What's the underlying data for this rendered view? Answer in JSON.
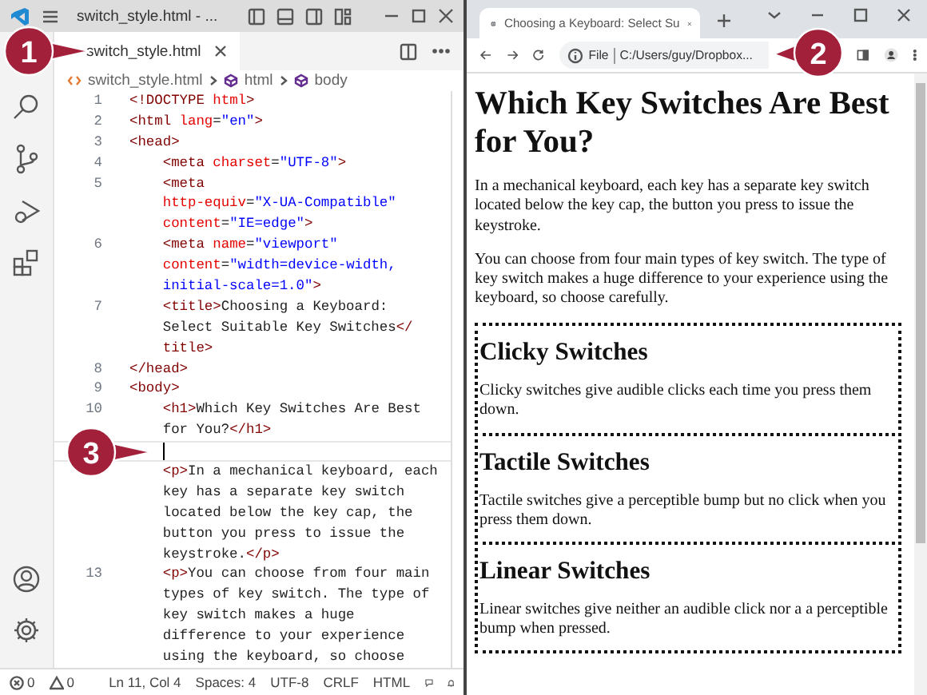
{
  "editor": {
    "title": "switch_style.html - ...",
    "tabs": [
      {
        "label": "switch_style.html",
        "selected": true
      }
    ],
    "breadcrumb": [
      "switch_style.html",
      "html",
      "body"
    ],
    "lines": [
      {
        "number": "1",
        "current": false,
        "rows": [
          {
            "tokens": [
              {
                "kind": "tag",
                "text": "<!DOCTYPE "
              },
              {
                "kind": "attr",
                "text": "html"
              },
              {
                "kind": "tag",
                "text": ">"
              }
            ]
          }
        ]
      },
      {
        "number": "2",
        "current": false,
        "rows": [
          {
            "tokens": [
              {
                "kind": "tag",
                "text": "<html "
              },
              {
                "kind": "attr",
                "text": "lang"
              },
              {
                "kind": "text",
                "text": "="
              },
              {
                "kind": "str",
                "text": "\"en\""
              },
              {
                "kind": "tag",
                "text": ">"
              }
            ]
          }
        ]
      },
      {
        "number": "3",
        "current": false,
        "rows": [
          {
            "tokens": [
              {
                "kind": "tag",
                "text": "<head>"
              }
            ]
          }
        ]
      },
      {
        "number": "4",
        "current": false,
        "rows": [
          {
            "tokens": [
              {
                "kind": "tag",
                "text": "    <meta "
              },
              {
                "kind": "attr",
                "text": "charset"
              },
              {
                "kind": "text",
                "text": "="
              },
              {
                "kind": "str",
                "text": "\"UTF-8\""
              },
              {
                "kind": "tag",
                "text": ">"
              }
            ]
          }
        ]
      },
      {
        "number": "5",
        "current": false,
        "rows": [
          {
            "tokens": [
              {
                "kind": "tag",
                "text": "    <meta"
              }
            ]
          },
          {
            "tokens": [
              {
                "kind": "attr",
                "text": "    http-equiv"
              },
              {
                "kind": "text",
                "text": "="
              },
              {
                "kind": "str",
                "text": "\"X-UA-Compatible\""
              }
            ]
          },
          {
            "tokens": [
              {
                "kind": "attr",
                "text": "    content"
              },
              {
                "kind": "text",
                "text": "="
              },
              {
                "kind": "str",
                "text": "\"IE=edge\""
              },
              {
                "kind": "tag",
                "text": ">"
              }
            ]
          }
        ]
      },
      {
        "number": "6",
        "current": false,
        "rows": [
          {
            "tokens": [
              {
                "kind": "tag",
                "text": "    <meta "
              },
              {
                "kind": "attr",
                "text": "name"
              },
              {
                "kind": "text",
                "text": "="
              },
              {
                "kind": "str",
                "text": "\"viewport\""
              }
            ]
          },
          {
            "tokens": [
              {
                "kind": "attr",
                "text": "    content"
              },
              {
                "kind": "text",
                "text": "="
              },
              {
                "kind": "str",
                "text": "\"width=device-width,"
              }
            ]
          },
          {
            "tokens": [
              {
                "kind": "str",
                "text": "    initial-scale=1.0\""
              },
              {
                "kind": "tag",
                "text": ">"
              }
            ]
          }
        ]
      },
      {
        "number": "7",
        "current": false,
        "rows": [
          {
            "tokens": [
              {
                "kind": "tag",
                "text": "    <title>"
              },
              {
                "kind": "text",
                "text": "Choosing a Keyboard:"
              }
            ]
          },
          {
            "tokens": [
              {
                "kind": "text",
                "text": "    Select Suitable Key Switches"
              },
              {
                "kind": "tag",
                "text": "</"
              }
            ]
          },
          {
            "tokens": [
              {
                "kind": "tag",
                "text": "    title>"
              }
            ]
          }
        ]
      },
      {
        "number": "8",
        "current": false,
        "rows": [
          {
            "tokens": [
              {
                "kind": "tag",
                "text": "</head>"
              }
            ]
          }
        ]
      },
      {
        "number": "9",
        "current": false,
        "rows": [
          {
            "tokens": [
              {
                "kind": "tag",
                "text": "<body>"
              }
            ]
          }
        ]
      },
      {
        "number": "10",
        "current": false,
        "rows": [
          {
            "tokens": [
              {
                "kind": "tag",
                "text": "    <h1>"
              },
              {
                "kind": "text",
                "text": "Which Key Switches Are Best"
              }
            ]
          },
          {
            "tokens": [
              {
                "kind": "text",
                "text": "    for You?"
              },
              {
                "kind": "tag",
                "text": "</h1>"
              }
            ]
          }
        ]
      },
      {
        "current": true,
        "rows": [
          {}
        ]
      },
      {
        "current": false,
        "rows": [
          {
            "tokens": [
              {
                "kind": "tag",
                "text": "    <p>"
              },
              {
                "kind": "text",
                "text": "In a mechanical keyboard, each"
              }
            ]
          },
          {
            "tokens": [
              {
                "kind": "text",
                "text": "    key has a separate key switch"
              }
            ]
          },
          {
            "tokens": [
              {
                "kind": "text",
                "text": "    located below the key cap, the"
              }
            ]
          },
          {
            "tokens": [
              {
                "kind": "text",
                "text": "    button you press to issue the"
              }
            ]
          },
          {
            "tokens": [
              {
                "kind": "text",
                "text": "    keystroke."
              },
              {
                "kind": "tag",
                "text": "</p>"
              }
            ]
          }
        ]
      },
      {
        "number": "13",
        "current": false,
        "rows": [
          {
            "tokens": [
              {
                "kind": "tag",
                "text": "    <p>"
              },
              {
                "kind": "text",
                "text": "You can choose from four main"
              }
            ]
          },
          {
            "tokens": [
              {
                "kind": "text",
                "text": "    types of key switch. The type of"
              }
            ]
          },
          {
            "tokens": [
              {
                "kind": "text",
                "text": "    key switch makes a huge"
              }
            ]
          },
          {
            "tokens": [
              {
                "kind": "text",
                "text": "    difference to your experience"
              }
            ]
          },
          {
            "tokens": [
              {
                "kind": "text",
                "text": "    using the keyboard, so choose"
              }
            ]
          }
        ]
      }
    ],
    "status_bar": {
      "errors": "0",
      "warnings": "0",
      "items": [
        "Ln 11, Col 4",
        "Spaces: 4",
        "UTF-8",
        "CRLF",
        "HTML"
      ]
    }
  },
  "browser": {
    "tabs": [
      {
        "label": "Choosing a Keyboard: Select Su",
        "selected": true
      }
    ],
    "address": {
      "scheme": "File",
      "url": "C:/Users/guy/Dropbox..."
    },
    "page": {
      "heading": "Which Key Switches Are Best for You?",
      "paragraphs": [
        "In a mechanical keyboard, each key has a separate key switch located below the key cap, the button you press to issue the keystroke.",
        "You can choose from four main types of key switch. The type of key switch makes a huge difference to your experience using the keyboard, so choose carefully."
      ],
      "sections": [
        {
          "heading": "Clicky Switches",
          "text": "Clicky switches give audible clicks each time you press them down."
        },
        {
          "heading": "Tactile Switches",
          "text": "Tactile switches give a perceptible bump but no click when you press them down."
        },
        {
          "heading": "Linear Switches",
          "text": "Linear switches give neither an audible click nor a a perceptible bump when pressed."
        }
      ]
    }
  },
  "callouts": [
    "1",
    "2",
    "3"
  ]
}
